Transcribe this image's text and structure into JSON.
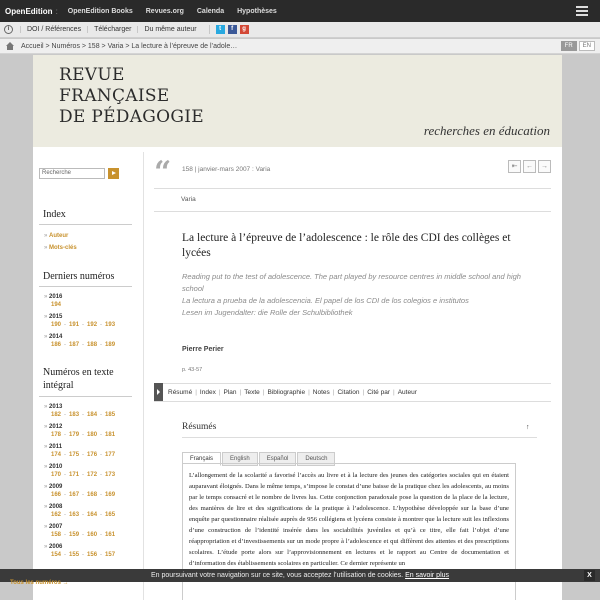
{
  "oe_bar": {
    "brand": "OpenEdition",
    "colon": ":",
    "links": [
      "OpenEdition Books",
      "Revues.org",
      "Calenda",
      "Hypothèses"
    ]
  },
  "tools": {
    "items": [
      "DOI / Références",
      "Télécharger",
      "Du même auteur"
    ],
    "share_icons": [
      "twitter-icon",
      "facebook-icon",
      "googleplus-icon"
    ]
  },
  "breadcrumb": {
    "text": "Accueil > Numéros > 158 > Varia > La lecture à l’épreuve de l’adole…",
    "languages": [
      {
        "code": "FR",
        "active": true
      },
      {
        "code": "EN",
        "active": false
      }
    ]
  },
  "banner": {
    "title_lines": [
      "REVUE",
      "FRANÇAISE",
      "DE PÉDAGOGIE"
    ],
    "subtitle": "recherches en éducation",
    "bg_color": "#ecebe0"
  },
  "sidebar": {
    "search_placeholder": "Recherche",
    "index_heading": "Index",
    "index_items": [
      "Auteur",
      "Mots-clés"
    ],
    "recent_heading": "Derniers numéros",
    "recent": [
      {
        "year": "2016",
        "issues": [
          "194"
        ]
      },
      {
        "year": "2015",
        "issues": [
          "190",
          "191",
          "192",
          "193"
        ]
      },
      {
        "year": "2014",
        "issues": [
          "186",
          "187",
          "188",
          "189"
        ]
      }
    ],
    "fulltext_heading_lines": [
      "Numéros en texte",
      "intégral"
    ],
    "fulltext": [
      {
        "year": "2013",
        "issues": [
          "182",
          "183",
          "184",
          "185"
        ]
      },
      {
        "year": "2012",
        "issues": [
          "178",
          "179",
          "180",
          "181"
        ]
      },
      {
        "year": "2011",
        "issues": [
          "174",
          "175",
          "176",
          "177"
        ]
      },
      {
        "year": "2010",
        "issues": [
          "170",
          "171",
          "172",
          "173"
        ]
      },
      {
        "year": "2009",
        "issues": [
          "166",
          "167",
          "168",
          "169"
        ]
      },
      {
        "year": "2008",
        "issues": [
          "162",
          "163",
          "164",
          "165"
        ]
      },
      {
        "year": "2007",
        "issues": [
          "158",
          "159",
          "160",
          "161"
        ]
      },
      {
        "year": "2006",
        "issues": [
          "154",
          "155",
          "156",
          "157"
        ]
      }
    ],
    "all_issues": "Tous les numéros →",
    "accent_color": "#c8922e"
  },
  "article": {
    "issue_line": "158 | janvier-mars 2007 : Varia",
    "nav_buttons": [
      "⇤",
      "←",
      "→"
    ],
    "rubric": "Varia",
    "title": "La lecture à l’épreuve de l’adolescence : le rôle des CDI des collèges et lycées",
    "alt_titles": [
      "Reading put to the test of adolescence. The part played by resource centres in middle school and high school",
      "La lectura a prueba de la adolescencia. El papel de los CDI de los colegios e institutos",
      "Lesen im Jugendalter: die Rolle der Schulbibliothek"
    ],
    "author": "Pierre Perier",
    "pages": "p. 43-57",
    "anchors": [
      "Résumé",
      "Index",
      "Plan",
      "Texte",
      "Bibliographie",
      "Notes",
      "Citation",
      "Cité par",
      "Auteur"
    ],
    "resumes_heading": "Résumés",
    "resumes_arrow": "↑",
    "tabs": [
      "Français",
      "English",
      "Español",
      "Deutsch"
    ],
    "active_tab": "Français",
    "abstract": "L’allongement de la scolarité a favorisé l’accès au livre et à la lecture des jeunes des catégories sociales qui en étaient auparavant éloignés. Dans le même temps, s’impose le constat d’une baisse de la pratique chez les adolescents, au moins par le temps consacré et le nombre de livres lus. Cette conjonction paradoxale pose la question de la place de la lecture, des manières de lire et des significations de la pratique à l’adolescence. L’hypothèse développée sur la base d’une enquête par questionnaire réalisée auprès de 956 collégiens et lycéens consiste à montrer que la lecture suit les inflexions d’une construction de l’identité insérée dans les sociabilités juvéniles et qu’à ce titre, elle fait l’objet d’une réappropriation et d’investissements sur un mode propre à l’adolescence et qui diffèrent des attentes et des prescriptions scolaires. L’étude porte alors sur l’approvisionnement en lectures et le rapport au Centre de documentation et d’information des établissements scolaires en particulier. Ce dernier représente un"
  },
  "cookie": {
    "text": "En poursuivant votre navigation sur ce site, vous acceptez l’utilisation de cookies.",
    "link": "En savoir plus",
    "close": "X"
  }
}
